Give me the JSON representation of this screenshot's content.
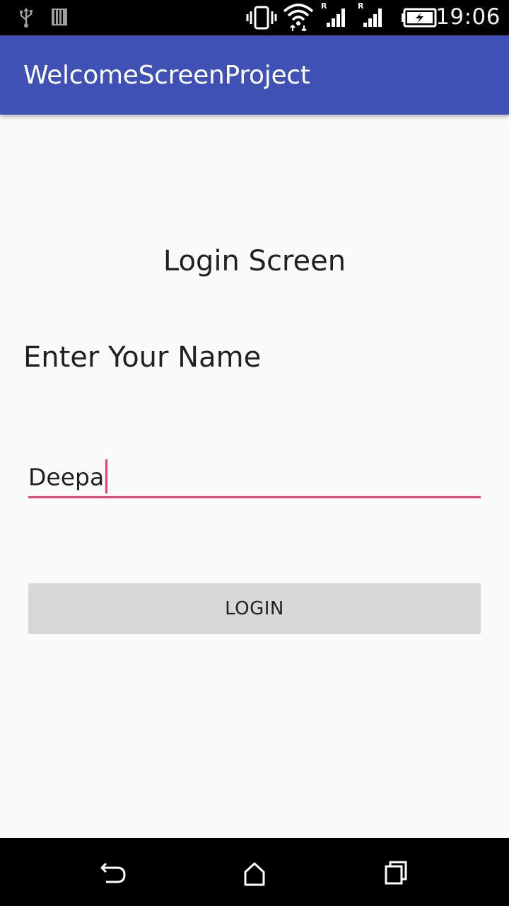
{
  "status_bar": {
    "time": "19:06",
    "icons": [
      "usb-icon",
      "sim-card-icon",
      "vibrate-icon",
      "wifi-icon",
      "signal-icon",
      "battery-charging-icon"
    ],
    "roaming_marker": "R"
  },
  "app_bar": {
    "title": "WelcomeScreenProject",
    "color": "#3f51b5"
  },
  "main": {
    "heading": "Login Screen",
    "name_label": "Enter Your Name",
    "name_input": {
      "value": "Deepa",
      "accent_color": "#ec407a"
    },
    "login_button_label": "LOGIN"
  },
  "nav_bar": {
    "icons": [
      "back-icon",
      "home-icon",
      "recents-icon"
    ]
  }
}
